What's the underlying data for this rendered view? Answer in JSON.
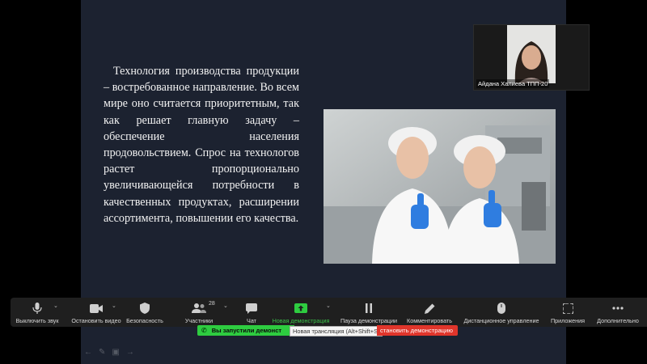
{
  "slide": {
    "paragraph": "Технология производства продукции – востребованное направление. Во всем мире оно считается приоритетным, так как решает главную задачу – обеспечение населения продовольствием. Спрос на технологов растет пропорционально увеличивающейся потребности в качественных продуктах, расширении ассортимента, повышении его качества."
  },
  "participant_video": {
    "name": "Айдана Халиева ТПП-20"
  },
  "toolbar": {
    "mute_label": "Выключить звук",
    "video_label": "Остановить видео",
    "security_label": "Безопасность",
    "participants_label": "Участники",
    "participants_count": "28",
    "chat_label": "Чат",
    "new_share_label": "Новая демонстрация",
    "pause_share_label": "Пауза демонстрации",
    "annotate_label": "Комментировать",
    "remote_control_label": "Дистанционное управление",
    "apps_label": "Приложения",
    "more_label": "Дополнительно"
  },
  "share_bar": {
    "status_text": "Вы запустили демонст",
    "tooltip_text": "Новая трансляция (Alt+Shift+S)",
    "stop_text": "становить демонстрацию"
  },
  "colors": {
    "slide_bg": "#1c2230",
    "toolbar_bg": "#1f1f1f",
    "share_green": "#2ecc40",
    "stop_red": "#e0352b"
  }
}
